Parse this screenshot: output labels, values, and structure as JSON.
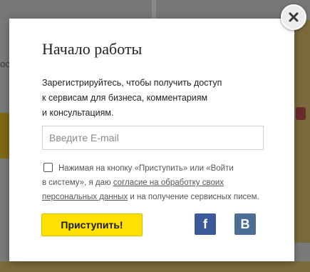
{
  "modal": {
    "title": "Начало работы",
    "description_lines": [
      "Зарегистрируйтесь, чтобы получить доступ",
      "к сервисам для бизнеса, комментариям",
      "и консультациям."
    ],
    "email_placeholder": "Введите E-mail",
    "email_value": "",
    "consent": {
      "checked": false,
      "text_line1": "Нажимая на кнопку «Приступить» или «Войти",
      "text_line2_prefix": "в систему», я даю ",
      "link_part1": "согласие на обработку своих",
      "link_part2": "персональных данных",
      "text_suffix": " и на получение сервисных писем."
    },
    "submit_label": "Приступить!",
    "social": {
      "facebook_label": "f",
      "vk_label": "B"
    }
  },
  "background": {
    "left_text_fragment": "ос"
  },
  "icons": {
    "close": "close-icon",
    "facebook": "facebook-icon",
    "vk": "vk-icon"
  },
  "colors": {
    "submit_bg": "#ffe000",
    "facebook": "#3b5a9a",
    "vk": "#4a6e96"
  }
}
